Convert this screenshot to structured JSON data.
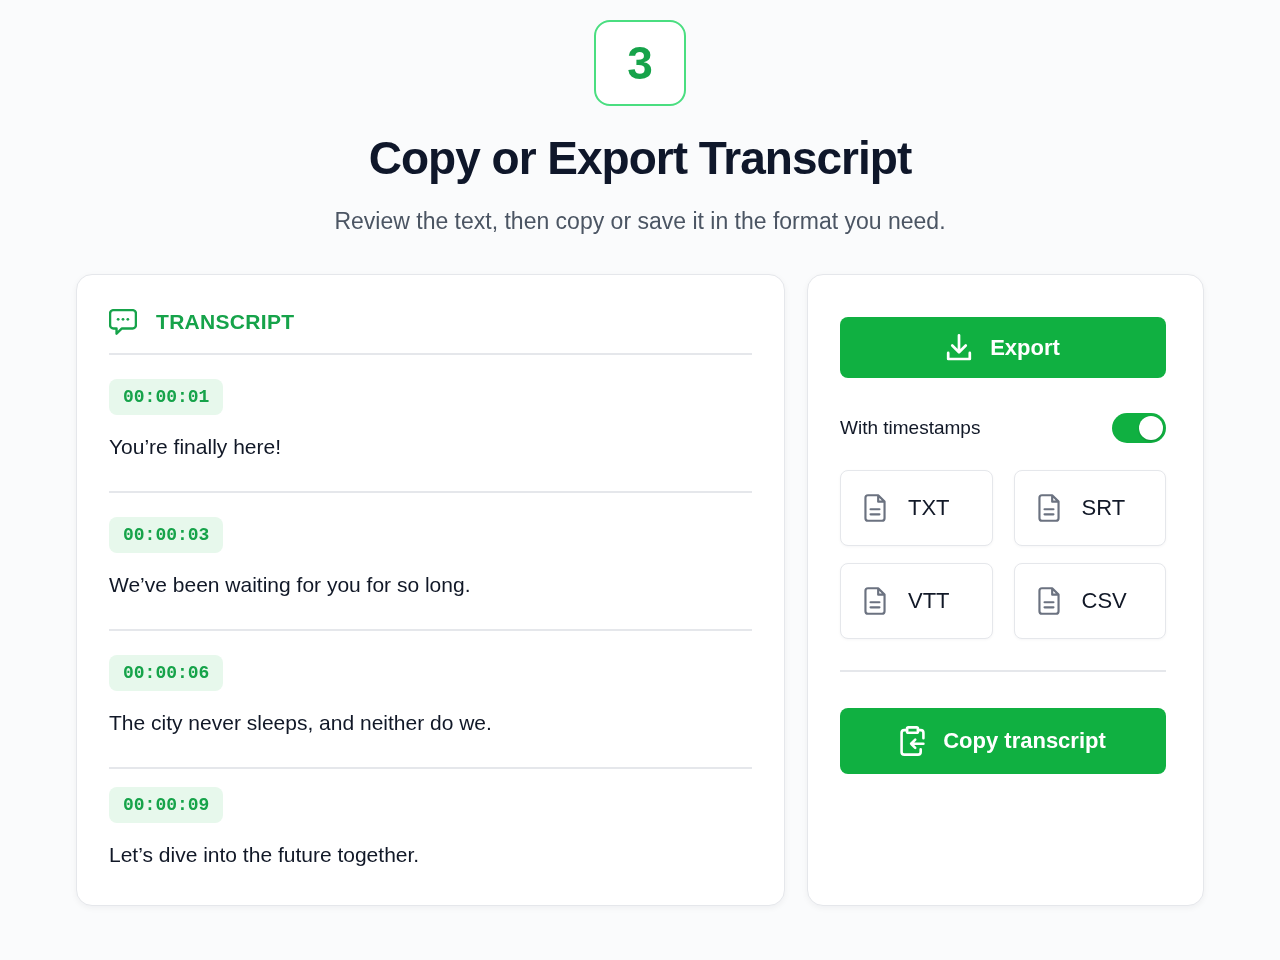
{
  "step": {
    "number": "3"
  },
  "header": {
    "title": "Copy or Export Transcript",
    "subtitle": "Review the text, then copy or save it in the format you need."
  },
  "transcript_panel": {
    "heading": "TRANSCRIPT",
    "entries": [
      {
        "timestamp": "00:00:01",
        "text": "You’re finally here!"
      },
      {
        "timestamp": "00:00:03",
        "text": "We’ve been waiting for you for so long."
      },
      {
        "timestamp": "00:00:06",
        "text": "The city never sleeps, and neither do we."
      },
      {
        "timestamp": "00:00:09",
        "text": "Let’s dive into the future together."
      }
    ]
  },
  "export_panel": {
    "export_button": "Export",
    "timestamps_toggle": {
      "label": "With timestamps",
      "on": true
    },
    "formats": [
      "TXT",
      "SRT",
      "VTT",
      "CSV"
    ],
    "copy_button": "Copy transcript"
  }
}
